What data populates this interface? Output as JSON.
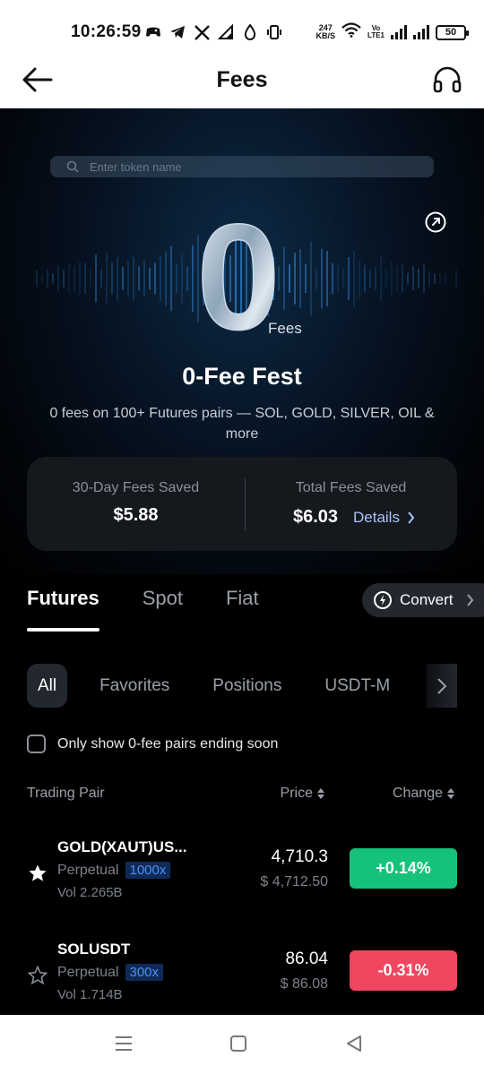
{
  "status_bar": {
    "time": "10:26:59",
    "net_speed_value": "247",
    "net_speed_unit": "KB/S",
    "volte_top": "Vo",
    "volte_bottom": "LTE1",
    "battery": "50"
  },
  "header": {
    "title": "Fees",
    "back_icon": "arrow-left-icon",
    "support_icon": "headset-icon"
  },
  "hero": {
    "search_placeholder": "Enter token name",
    "logo_zero": "0",
    "logo_fees": "Fees",
    "title": "0-Fee Fest",
    "subtitle": "0 fees on 100+ Futures pairs — SOL, GOLD, SILVER, OIL & more",
    "accent_color": "#3aa0ff"
  },
  "savings": {
    "thirty_day_label": "30-Day Fees Saved",
    "thirty_day_value": "$5.88",
    "total_label": "Total Fees Saved",
    "total_value": "$6.03",
    "details_label": "Details"
  },
  "tabs": [
    {
      "label": "Futures",
      "active": true
    },
    {
      "label": "Spot",
      "active": false
    },
    {
      "label": "Fiat",
      "active": false
    }
  ],
  "convert_label": "Convert",
  "filters": [
    {
      "label": "All",
      "active": true
    },
    {
      "label": "Favorites",
      "active": false
    },
    {
      "label": "Positions",
      "active": false
    },
    {
      "label": "USDT-M",
      "active": false
    }
  ],
  "checkbox_label": "Only show 0-fee pairs ending soon",
  "table": {
    "col_pair": "Trading Pair",
    "col_price": "Price",
    "col_change": "Change",
    "rows": [
      {
        "pair": "GOLD(XAUT)US...",
        "type": "Perpetual",
        "leverage": "1000x",
        "volume": "Vol 2.265B",
        "price": "4,710.3",
        "fiat_price": "$ 4,712.50",
        "change": "+0.14%",
        "change_color": "#16c27a",
        "favorited": true
      },
      {
        "pair": "SOLUSDT",
        "type": "Perpetual",
        "leverage": "300x",
        "volume": "Vol 1.714B",
        "price": "86.04",
        "fiat_price": "$ 86.08",
        "change": "-0.31%",
        "change_color": "#f0465f",
        "favorited": false
      }
    ]
  },
  "colors": {
    "positive": "#16c27a",
    "negative": "#f0465f",
    "leverage_text": "#4d8ff2",
    "leverage_bg": "#0f2a57"
  }
}
